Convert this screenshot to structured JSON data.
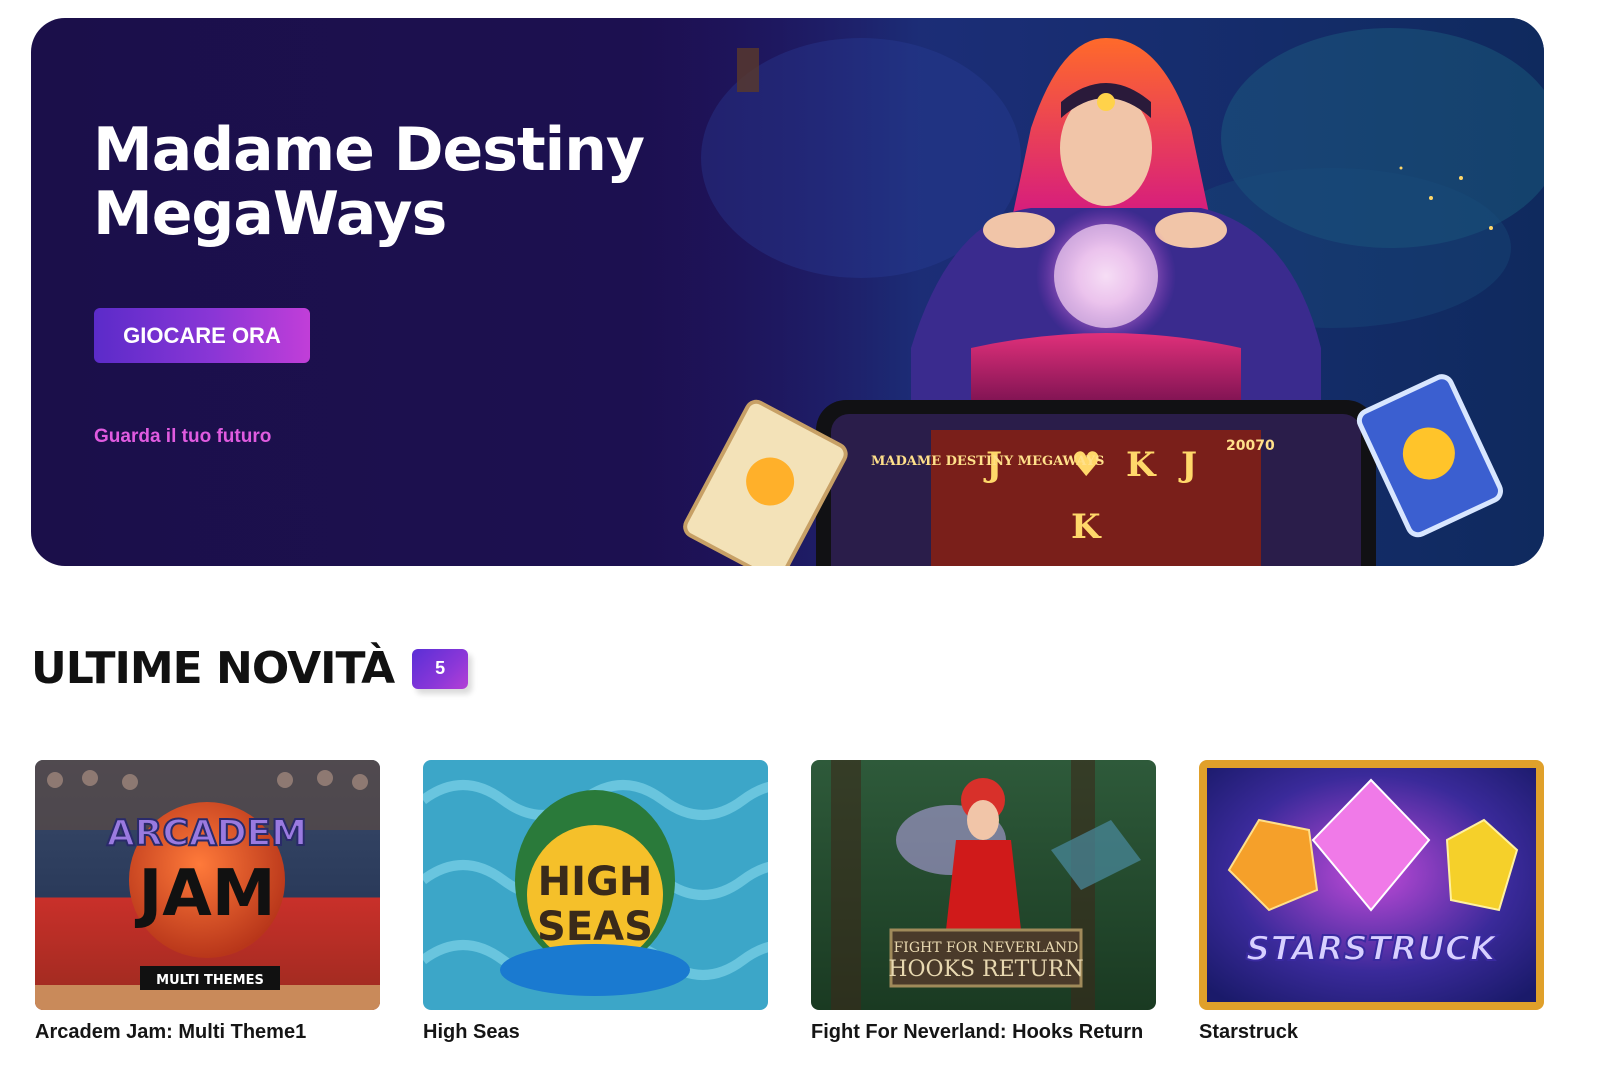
{
  "hero": {
    "title_line1": "Madame Destiny",
    "title_line2": "MegaWays",
    "cta_label": "GIOCARE ORA",
    "tagline": "Guarda il tuo futuro",
    "screen_logo": "MADAME DESTINY MEGAWAYS",
    "screen_counter": "20070"
  },
  "section": {
    "title": "ULTIME NOVITÀ",
    "count": "5"
  },
  "games": [
    {
      "name": "Arcadem Jam: Multi Theme1",
      "logo_top": "ARCADEM",
      "logo_main": "JAM",
      "logo_sub": "MULTI THEMES"
    },
    {
      "name": "High Seas",
      "logo_top": "HIGH",
      "logo_main": "SEAS"
    },
    {
      "name": "Fight For Neverland: Hooks Return",
      "logo_top": "FIGHT FOR NEVERLAND",
      "logo_main": "HOOKS RETURN"
    },
    {
      "name": "Starstruck",
      "logo_main": "STARSTRUCK"
    }
  ],
  "colors": {
    "hero_bg": "#1b0f4a",
    "accent": "#8a36d6",
    "tagline": "#e05be0"
  }
}
